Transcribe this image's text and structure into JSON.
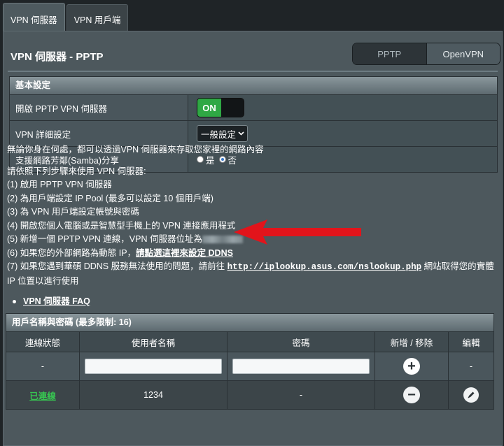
{
  "tabs": [
    {
      "label": "VPN 伺服器"
    },
    {
      "label": "VPN 用戶端"
    }
  ],
  "page_title": "VPN 伺服器 - PPTP",
  "protocol_switch": {
    "pptp": "PPTP",
    "openvpn": "OpenVPN"
  },
  "basic": {
    "header": "基本設定",
    "rows": [
      {
        "label": "開啟 PPTP VPN 伺服器",
        "toggle": "ON"
      },
      {
        "label": "VPN 詳細設定",
        "select": "一般設定"
      },
      {
        "label": "支援網路芳鄰(Samba)分享",
        "radio_yes": "是",
        "radio_no": "否",
        "selected": "否"
      }
    ]
  },
  "info": {
    "intro": "無論你身在何處，都可以透過VPN 伺服器來存取您家裡的網路內容",
    "steps_title": "請依照下列步驟來使用 VPN 伺服器:",
    "step1": "(1) 啟用 PPTP VPN 伺服器",
    "step2": "(2) 為用戶端設定 IP Pool (最多可以設定 10 個用戶端)",
    "step3": "(3) 為 VPN 用戶端設定帳號與密碼",
    "step4": "(4) 開啟您個人電腦或是智慧型手機上的 VPN 連接應用程式",
    "step5": "(5) 新增一個 PPTP VPN 連線，VPN 伺服器位址為",
    "step6_prefix": "(6) 如果您的外部網路為動態 IP，",
    "step6_link": "請點選這裡來設定 DDNS",
    "step7_prefix": "(7) 如果您遇到華碩 DDNS 服務無法使用的問題，請前往 ",
    "step7_link": "http://iplookup.asus.com/nslookup.php",
    "step7_suffix": " 網站取得您的實體",
    "step7_line2": "IP 位置以進行使用",
    "faq": "VPN 伺服器 FAQ"
  },
  "users": {
    "header": "用戶名稱與密碼 (最多限制: 16)",
    "columns": [
      "連線狀態",
      "使用者名稱",
      "密碼",
      "新增 / 移除",
      "編輯"
    ],
    "add_row": {
      "status": "-",
      "edit": "-"
    },
    "rows": [
      {
        "status": "已連線",
        "username": "1234",
        "password": "-"
      }
    ]
  },
  "colors": {
    "accent_green": "#2fa844",
    "arrow_red": "#e2141b",
    "connected_green": "#37c551"
  }
}
